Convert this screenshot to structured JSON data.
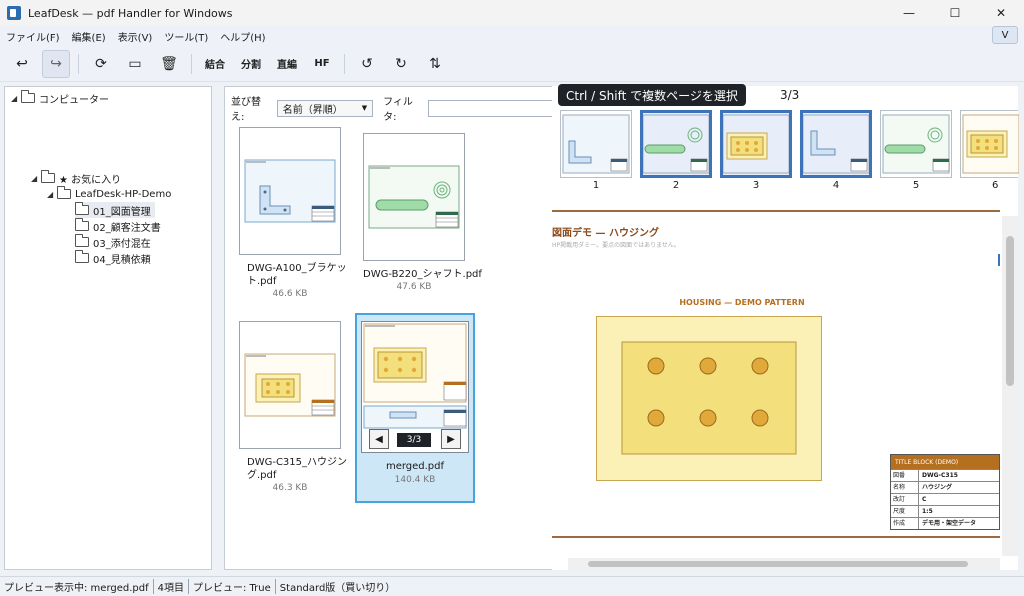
{
  "window": {
    "title": "LeafDesk — pdf Handler for Windows",
    "minimize": "—",
    "maximize": "☐",
    "close": "✕"
  },
  "menu": {
    "items": [
      "ファイル(F)",
      "編集(E)",
      "表示(V)",
      "ツール(T)",
      "ヘルプ(H)"
    ],
    "collapse_label": "V"
  },
  "toolbar": {
    "undo": "↩",
    "redo": "↪",
    "refresh": "⟳",
    "open_folder": "▭",
    "delete": "🗑",
    "combine": "結合",
    "split": "分割",
    "direct_edit": "直編",
    "hf": "HF",
    "rotate_left": "↺",
    "rotate_right": "↻",
    "sort": "⇅"
  },
  "tree": {
    "root": "コンピューター",
    "favorites": "★ お気に入り",
    "demo": "LeafDesk-HP-Demo",
    "folders": [
      "01_図面管理",
      "02_顧客注文書",
      "03_添付混在",
      "04_見積依頼"
    ]
  },
  "filelist": {
    "sort_label": "並び替え:",
    "sort_value": "名前（昇順）",
    "filter_label": "フィルタ:",
    "filter_value": "",
    "files": [
      {
        "name": "DWG-A100_ブラケット.pdf",
        "size": "46.6 KB"
      },
      {
        "name": "DWG-B220_シャフト.pdf",
        "size": "47.6 KB"
      },
      {
        "name": "DWG-C315_ハウジング.pdf",
        "size": "46.3 KB"
      },
      {
        "name": "merged.pdf",
        "size": "140.4 KB"
      }
    ],
    "merged_pager": "3/3",
    "prev": "◀",
    "next": "▶"
  },
  "preview": {
    "tooltip": "Ctrl / Shift で複数ページを選択",
    "page_count": "3/3",
    "pages": [
      "1",
      "2",
      "3",
      "4",
      "5",
      "6"
    ],
    "doc_title": "図面デモ — ハウジング",
    "doc_subtitle": "HP掲載用ダミー。要点の図面ではありません。",
    "drawing_label": "HOUSING — DEMO PATTERN",
    "title_block": {
      "header": "TITLE BLOCK (DEMO)",
      "rows": [
        {
          "k": "図番",
          "v": "DWG-C315"
        },
        {
          "k": "名称",
          "v": "ハウジング"
        },
        {
          "k": "改訂",
          "v": "C"
        },
        {
          "k": "尺度",
          "v": "1:5"
        },
        {
          "k": "作成",
          "v": "デモ用・架空データ"
        }
      ]
    }
  },
  "status": {
    "items": [
      "プレビュー表示中: merged.pdf",
      "4項目",
      "プレビュー: True",
      "Standard版（買い切り）"
    ]
  },
  "colors": {
    "accent": "#45a3dd",
    "selected_page": "#3d73b8",
    "rule": "#9c6a3c",
    "title_block": "#b5701f",
    "housing_fill": "#fbf1b6",
    "hole": "#e0a93a"
  }
}
